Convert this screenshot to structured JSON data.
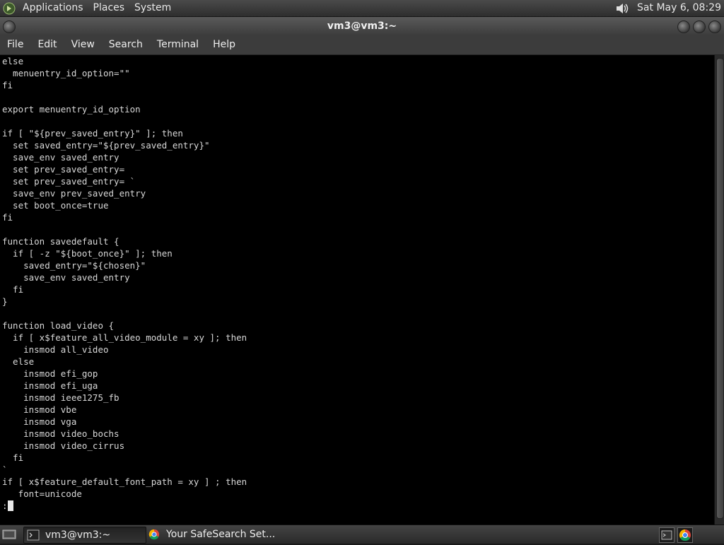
{
  "top_panel": {
    "menus": [
      "Applications",
      "Places",
      "System"
    ],
    "clock": "Sat May  6, 08:29",
    "icons": [
      "gnome-foot-icon",
      "volume-icon"
    ]
  },
  "window": {
    "title": "vm3@vm3:~"
  },
  "menubar": {
    "items": [
      "File",
      "Edit",
      "View",
      "Search",
      "Terminal",
      "Help"
    ]
  },
  "terminal": {
    "lines": [
      "else",
      "  menuentry_id_option=\"\"",
      "fi",
      "",
      "export menuentry_id_option",
      "",
      "if [ \"${prev_saved_entry}\" ]; then",
      "  set saved_entry=\"${prev_saved_entry}\"",
      "  save_env saved_entry",
      "  set prev_saved_entry=",
      "  set prev_saved_entry= `",
      "  save_env prev_saved_entry",
      "  set boot_once=true",
      "fi",
      "",
      "function savedefault {",
      "  if [ -z \"${boot_once}\" ]; then",
      "    saved_entry=\"${chosen}\"",
      "    save_env saved_entry",
      "  fi",
      "}",
      "",
      "function load_video {",
      "  if [ x$feature_all_video_module = xy ]; then",
      "    insmod all_video",
      "  else",
      "    insmod efi_gop",
      "    insmod efi_uga",
      "    insmod ieee1275_fb",
      "    insmod vbe",
      "    insmod vga",
      "    insmod video_bochs",
      "    insmod video_cirrus",
      "  fi",
      "`",
      "if [ x$feature_default_font_path = xy ] ; then",
      "   font=unicode"
    ],
    "prompt": ":"
  },
  "taskbar": {
    "tasks": [
      {
        "label": "vm3@vm3:~",
        "icon": "terminal-icon",
        "active": true
      },
      {
        "label": "Your SafeSearch Set...",
        "icon": "chrome-icon",
        "active": false
      }
    ],
    "tray": [
      "terminal-tray-icon",
      "chrome-tray-icon"
    ]
  },
  "colors": {
    "terminal_bg": "#000000",
    "terminal_fg": "#d8d8d8",
    "panel_bg": "#3c3c3c"
  }
}
